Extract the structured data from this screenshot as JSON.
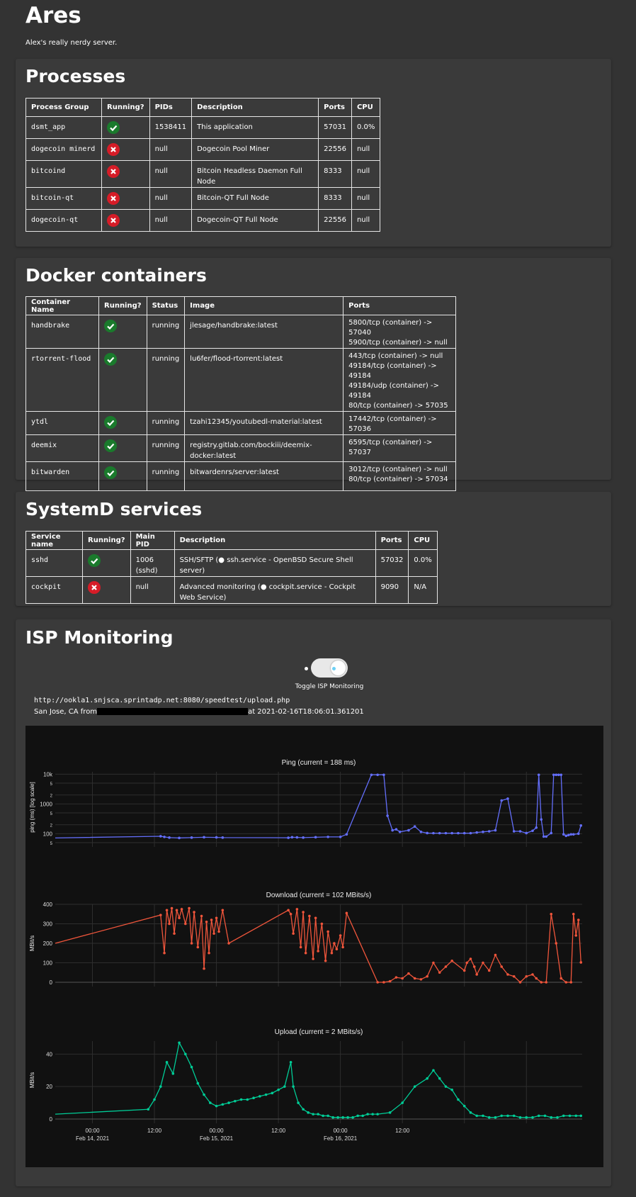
{
  "page": {
    "title": "Ares",
    "subtitle": "Alex's really nerdy server."
  },
  "processes": {
    "heading": "Processes",
    "columns": [
      "Process Group",
      "Running?",
      "PIDs",
      "Description",
      "Ports",
      "CPU"
    ],
    "rows": [
      {
        "group": "dsmt_app",
        "running": true,
        "pids": "1538411",
        "description": "This application",
        "ports": "57031",
        "cpu": "0.0%"
      },
      {
        "group": "dogecoin minerd",
        "running": false,
        "pids": "null",
        "description": "Dogecoin Pool Miner",
        "ports": "22556",
        "cpu": "null"
      },
      {
        "group": "bitcoind",
        "running": false,
        "pids": "null",
        "description": "Bitcoin Headless Daemon Full Node",
        "ports": "8333",
        "cpu": "null"
      },
      {
        "group": "bitcoin-qt",
        "running": false,
        "pids": "null",
        "description": "Bitcoin-QT Full Node",
        "ports": "8333",
        "cpu": "null"
      },
      {
        "group": "dogecoin-qt",
        "running": false,
        "pids": "null",
        "description": "Dogecoin-QT Full Node",
        "ports": "22556",
        "cpu": "null"
      }
    ]
  },
  "docker": {
    "heading": "Docker containers",
    "columns": [
      "Container Name",
      "Running?",
      "Status",
      "Image",
      "Ports"
    ],
    "rows": [
      {
        "name": "handbrake",
        "running": true,
        "status": "running",
        "image": "jlesage/handbrake:latest",
        "ports": [
          "5800/tcp (container) -> 57040",
          "5900/tcp (container) -> null"
        ]
      },
      {
        "name": "rtorrent-flood",
        "running": true,
        "status": "running",
        "image": "lu6fer/flood-rtorrent:latest",
        "ports": [
          "443/tcp (container) -> null",
          "49184/tcp (container) -> 49184",
          "49184/udp (container) -> 49184",
          "80/tcp (container) -> 57035"
        ]
      },
      {
        "name": "ytdl",
        "running": true,
        "status": "running",
        "image": "tzahi12345/youtubedl-material:latest",
        "ports": [
          "17442/tcp (container) -> 57036"
        ]
      },
      {
        "name": "deemix",
        "running": true,
        "status": "running",
        "image": "registry.gitlab.com/bockiii/deemix-docker:latest",
        "ports": [
          "6595/tcp (container) -> 57037"
        ]
      },
      {
        "name": "bitwarden",
        "running": true,
        "status": "running",
        "image": "bitwardenrs/server:latest",
        "ports": [
          "3012/tcp (container) -> null",
          "80/tcp (container) -> 57034"
        ]
      }
    ]
  },
  "systemd": {
    "heading": "SystemD services",
    "columns": [
      "Service name",
      "Running?",
      "Main PID",
      "Description",
      "Ports",
      "CPU"
    ],
    "rows": [
      {
        "name": "sshd",
        "running": true,
        "pid": "1006 (sshd)",
        "description": "SSH/SFTP (● ssh.service - OpenBSD Secure Shell server)",
        "ports": "57032",
        "cpu": "0.0%"
      },
      {
        "name": "cockpit",
        "running": false,
        "pid": "null",
        "description": "Advanced monitoring (● cockpit.service - Cockpit Web Service)",
        "ports": "9090",
        "cpu": "N/A"
      }
    ]
  },
  "isp": {
    "heading": "ISP Monitoring",
    "toggle_label": "Toggle ISP Monitoring",
    "toggle_on": true,
    "url": "http://ookla1.snjsca.sprintadp.net:8080/speedtest/upload.php",
    "location_prefix": "San Jose, CA from",
    "location_suffix": "at 2021-02-16T18:06:01.361201"
  },
  "colors": {
    "ping": "#636efa",
    "download": "#ef553b",
    "upload": "#00cc96",
    "ok": "#1a7a2c",
    "bad": "#d61c27"
  },
  "chart_data": [
    {
      "type": "line",
      "title": "Ping (current = 188 ms)",
      "ylabel": "ping (ms) [log scale]",
      "yscale": "log",
      "ylim": [
        50,
        12000
      ],
      "y_tick_labels": [
        "10k",
        "5",
        "2",
        "1000",
        "5",
        "2",
        "100",
        "5"
      ],
      "x": [
        -0.3,
        0.55,
        0.58,
        0.62,
        0.7,
        0.8,
        0.9,
        1.0,
        1.05,
        1.58,
        1.61,
        1.65,
        1.7,
        1.8,
        1.9,
        2.0,
        2.05,
        2.25,
        2.3,
        2.35,
        2.38,
        2.42,
        2.45,
        2.48,
        2.55,
        2.6,
        2.65,
        2.7,
        2.75,
        2.8,
        2.85,
        2.9,
        2.95,
        3.0,
        3.05,
        3.1,
        3.15,
        3.2,
        3.25,
        3.3,
        3.35,
        3.4,
        3.45,
        3.5,
        3.55,
        3.58,
        3.6,
        3.62,
        3.64,
        3.66,
        3.7,
        3.72,
        3.74,
        3.76,
        3.78,
        3.8,
        3.82,
        3.84,
        3.86,
        3.88,
        3.92,
        3.94
      ],
      "y": [
        72,
        82,
        78,
        74,
        72,
        74,
        76,
        75,
        74,
        73,
        76,
        75,
        74,
        76,
        78,
        78,
        95,
        9500,
        9500,
        9500,
        400,
        130,
        140,
        115,
        130,
        175,
        115,
        105,
        104,
        104,
        104,
        104,
        104,
        104,
        104,
        110,
        115,
        120,
        130,
        1300,
        1500,
        120,
        120,
        105,
        125,
        160,
        9500,
        300,
        80,
        80,
        105,
        9500,
        9500,
        9500,
        9500,
        95,
        85,
        90,
        95,
        95,
        100,
        188
      ],
      "x_tick_labels": [
        "00:00",
        "12:00",
        "00:00",
        "12:00",
        "00:00",
        "12:00"
      ],
      "x_date_labels": [
        "Feb 14, 2021",
        "Feb 15, 2021",
        "Feb 16, 2021"
      ]
    },
    {
      "type": "line",
      "title": "Download (current = 102 MBits/s)",
      "ylabel": "MBit/s",
      "ylim": [
        0,
        400
      ],
      "y_ticks": [
        0,
        100,
        200,
        300,
        400
      ],
      "x": [
        -0.3,
        0.55,
        0.58,
        0.6,
        0.62,
        0.64,
        0.66,
        0.68,
        0.7,
        0.72,
        0.75,
        0.78,
        0.8,
        0.82,
        0.85,
        0.88,
        0.9,
        0.92,
        0.94,
        0.96,
        0.98,
        1.0,
        1.02,
        1.05,
        1.1,
        1.58,
        1.6,
        1.62,
        1.65,
        1.68,
        1.7,
        1.72,
        1.75,
        1.78,
        1.8,
        1.82,
        1.85,
        1.88,
        1.9,
        1.93,
        1.95,
        1.97,
        2.0,
        2.02,
        2.05,
        2.3,
        2.35,
        2.4,
        2.45,
        2.5,
        2.55,
        2.6,
        2.65,
        2.7,
        2.75,
        2.8,
        2.85,
        2.9,
        3.0,
        3.02,
        3.05,
        3.08,
        3.1,
        3.15,
        3.2,
        3.25,
        3.3,
        3.35,
        3.4,
        3.45,
        3.5,
        3.55,
        3.58,
        3.62,
        3.66,
        3.7,
        3.74,
        3.78,
        3.82,
        3.86,
        3.88,
        3.9,
        3.92,
        3.94
      ],
      "y": [
        200,
        345,
        150,
        370,
        300,
        380,
        250,
        370,
        330,
        375,
        300,
        380,
        200,
        360,
        180,
        340,
        70,
        310,
        150,
        320,
        250,
        330,
        260,
        370,
        200,
        370,
        350,
        250,
        375,
        180,
        360,
        150,
        340,
        120,
        330,
        160,
        300,
        110,
        260,
        150,
        200,
        170,
        240,
        180,
        355,
        0,
        0,
        5,
        25,
        20,
        45,
        20,
        15,
        30,
        100,
        50,
        80,
        110,
        60,
        100,
        120,
        80,
        40,
        100,
        60,
        140,
        80,
        40,
        30,
        0,
        30,
        40,
        20,
        0,
        0,
        350,
        200,
        20,
        0,
        0,
        350,
        240,
        320,
        102
      ],
      "x_tick_labels": [
        "00:00",
        "12:00",
        "00:00",
        "12:00",
        "00:00",
        "12:00"
      ],
      "x_date_labels": [
        "Feb 14, 2021",
        "Feb 15, 2021",
        "Feb 16, 2021"
      ]
    },
    {
      "type": "line",
      "title": "Upload (current = 2 MBits/s)",
      "ylabel": "MBit/s",
      "ylim": [
        0,
        48
      ],
      "y_ticks": [
        0,
        20,
        40
      ],
      "x": [
        -0.3,
        0.45,
        0.5,
        0.55,
        0.6,
        0.65,
        0.7,
        0.75,
        0.8,
        0.85,
        0.9,
        0.95,
        1.0,
        1.05,
        1.1,
        1.15,
        1.2,
        1.25,
        1.3,
        1.35,
        1.4,
        1.45,
        1.5,
        1.55,
        1.6,
        1.62,
        1.66,
        1.7,
        1.74,
        1.78,
        1.82,
        1.86,
        1.9,
        1.94,
        1.98,
        2.02,
        2.06,
        2.1,
        2.14,
        2.18,
        2.22,
        2.26,
        2.3,
        2.4,
        2.5,
        2.6,
        2.7,
        2.75,
        2.8,
        2.85,
        2.9,
        2.95,
        3.0,
        3.05,
        3.1,
        3.15,
        3.2,
        3.25,
        3.3,
        3.35,
        3.4,
        3.45,
        3.5,
        3.55,
        3.6,
        3.65,
        3.7,
        3.75,
        3.8,
        3.85,
        3.9,
        3.94
      ],
      "x_raw_note": "",
      "y": [
        3,
        6,
        12,
        20,
        35,
        28,
        47,
        40,
        32,
        22,
        15,
        10,
        8,
        9,
        10,
        11,
        12,
        12,
        13,
        14,
        15,
        16,
        18,
        20,
        35,
        20,
        10,
        6,
        4,
        3,
        3,
        2,
        2,
        1,
        1,
        1,
        1,
        1,
        2,
        2,
        3,
        3,
        3,
        4,
        10,
        20,
        25,
        30,
        25,
        20,
        18,
        12,
        8,
        4,
        2,
        2,
        1,
        1,
        2,
        2,
        2,
        1,
        1,
        1,
        2,
        2,
        1,
        1,
        2,
        2,
        2,
        2
      ],
      "x_tick_labels": [
        "00:00",
        "12:00",
        "00:00",
        "12:00",
        "00:00",
        "12:00"
      ],
      "x_date_labels": [
        "Feb 14, 2021",
        "Feb 15, 2021",
        "Feb 16, 2021"
      ]
    }
  ]
}
